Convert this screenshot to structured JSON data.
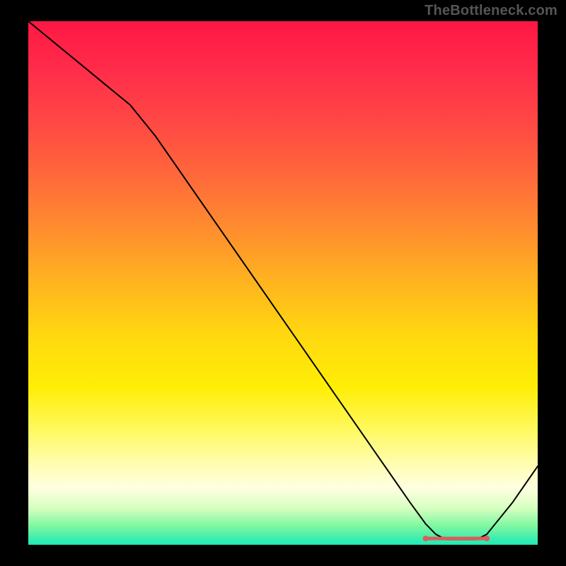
{
  "watermark": "TheBottleneck.com",
  "chart_data": {
    "type": "line",
    "title": "",
    "xlabel": "",
    "ylabel": "",
    "xlim": [
      0,
      100
    ],
    "ylim": [
      0,
      100
    ],
    "grid": false,
    "background_gradient": {
      "stops": [
        {
          "offset": 0.0,
          "color": "#ff1744"
        },
        {
          "offset": 0.1,
          "color": "#ff2e4a"
        },
        {
          "offset": 0.2,
          "color": "#ff4a44"
        },
        {
          "offset": 0.3,
          "color": "#ff6a3a"
        },
        {
          "offset": 0.4,
          "color": "#ff8e2e"
        },
        {
          "offset": 0.5,
          "color": "#ffb41f"
        },
        {
          "offset": 0.6,
          "color": "#ffd80f"
        },
        {
          "offset": 0.7,
          "color": "#ffee06"
        },
        {
          "offset": 0.78,
          "color": "#fff95f"
        },
        {
          "offset": 0.84,
          "color": "#fffdaa"
        },
        {
          "offset": 0.89,
          "color": "#ffffe0"
        },
        {
          "offset": 0.93,
          "color": "#d7ffc0"
        },
        {
          "offset": 0.965,
          "color": "#7bf7a0"
        },
        {
          "offset": 1.0,
          "color": "#1de9b6"
        }
      ]
    },
    "series": [
      {
        "name": "bottleneck-curve",
        "color": "#000000",
        "stroke_width": 2,
        "x": [
          0,
          5,
          10,
          15,
          20,
          25,
          30,
          35,
          40,
          45,
          50,
          55,
          60,
          65,
          70,
          75,
          78,
          80,
          82,
          86,
          88,
          90,
          95,
          100
        ],
        "y": [
          100,
          96,
          92,
          88,
          84,
          78,
          71,
          64,
          57,
          50,
          43,
          36,
          29,
          22,
          15,
          8,
          4,
          2,
          1,
          1,
          1,
          2,
          8,
          15
        ]
      }
    ],
    "highlight_band": {
      "name": "optimal-range-marker",
      "color": "#e05a5a",
      "x_start": 78,
      "x_end": 90,
      "y": 1.2
    }
  }
}
